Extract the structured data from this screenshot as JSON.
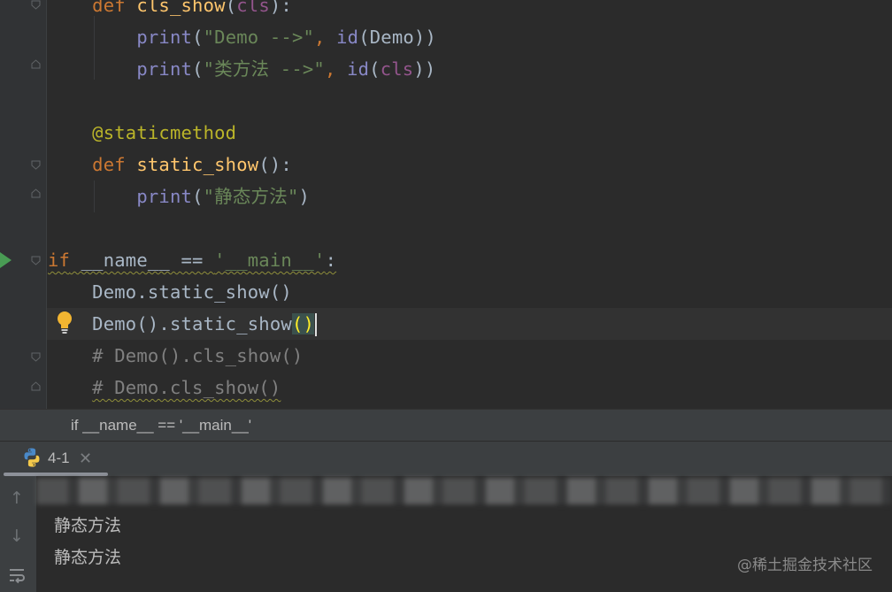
{
  "editor": {
    "lines": {
      "l1": {
        "def": "def ",
        "name": "cls_show",
        "open": "(",
        "param": "cls",
        "close": "):"
      },
      "l2": {
        "fn": "print",
        "open": "(",
        "str": "\"Demo -->\"",
        "comma": ", ",
        "id": "id",
        "rest": "(Demo))"
      },
      "l3": {
        "fn": "print",
        "open": "(",
        "str": "\"类方法 -->\"",
        "comma": ", ",
        "id": "id",
        "open2": "(",
        "param": "cls",
        "close": "))"
      },
      "l5": {
        "deco": "@staticmethod"
      },
      "l6": {
        "def": "def ",
        "name": "static_show",
        "rest": "():"
      },
      "l7": {
        "fn": "print",
        "open": "(",
        "str": "\"静态方法\"",
        "close": ")"
      },
      "l9": {
        "kw": "if",
        "mid": " __name__ == ",
        "str": "'__main__'",
        "colon": ":"
      },
      "l10": {
        "text": "Demo.static_show()"
      },
      "l11": {
        "text": "Demo().static_show",
        "paren": "()"
      },
      "l12": {
        "text": "# Demo().cls_show()"
      },
      "l13": {
        "text": "# Demo.cls_show()"
      }
    }
  },
  "breadcrumb": {
    "text": "if __name__ == '__main__'"
  },
  "run_panel": {
    "tab_label": "4-1",
    "tab_close": "✕",
    "output": [
      "静态方法",
      "静态方法"
    ]
  },
  "icons": {
    "run": "run-gutter-icon",
    "intention": "lightbulb-icon",
    "python": "python-icon",
    "up": "arrow-up-icon",
    "down": "arrow-down-icon",
    "wrap": "soft-wrap-icon"
  },
  "colors": {
    "keyword": "#cc7832",
    "function": "#ffc66d",
    "builtin": "#8888c6",
    "string": "#6a8759",
    "decorator": "#bbb529",
    "comment": "#808080"
  },
  "watermark": "@稀土掘金技术社区"
}
